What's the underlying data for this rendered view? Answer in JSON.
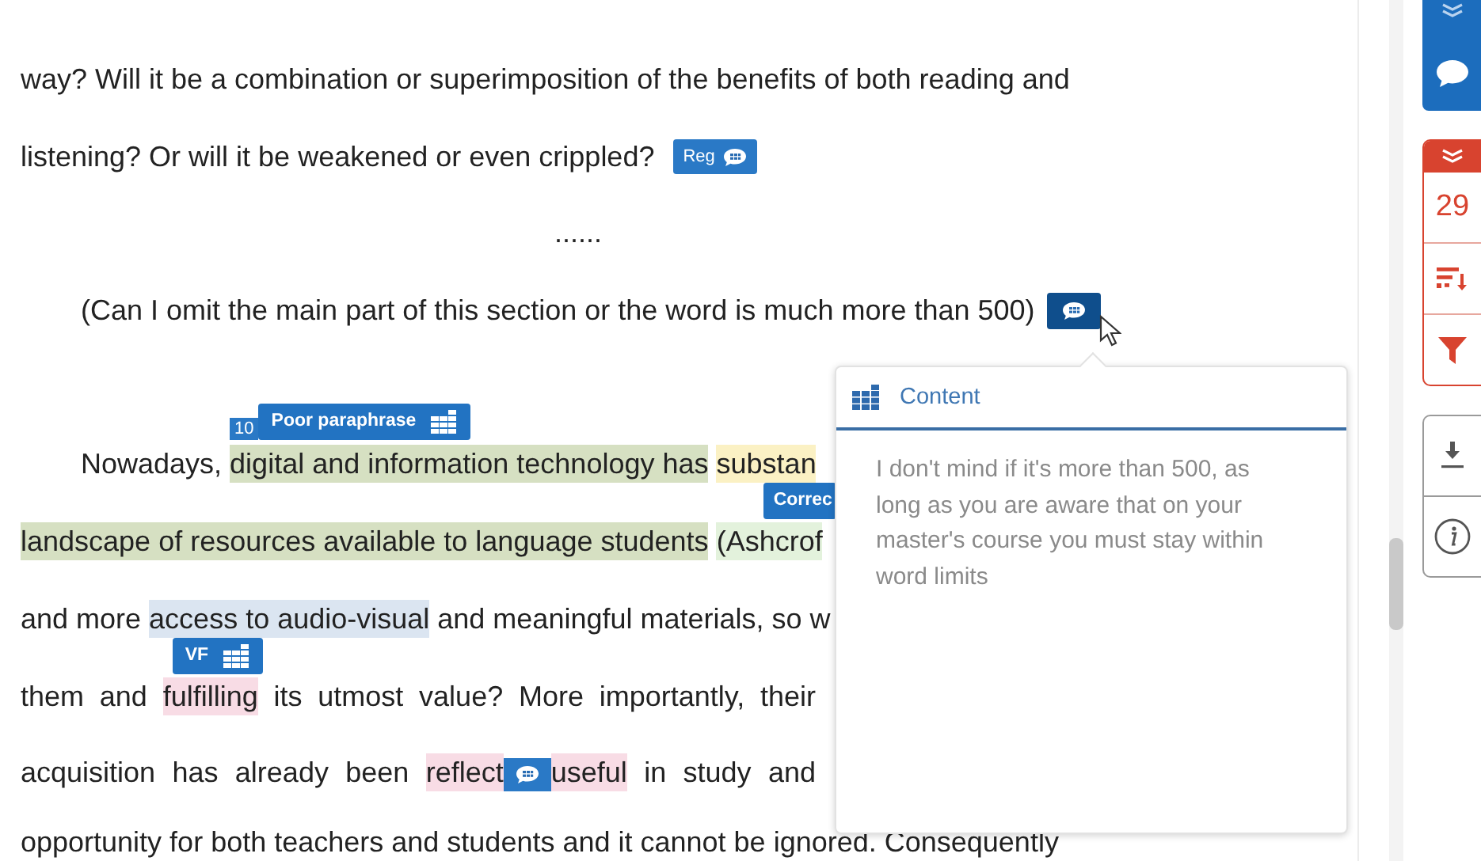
{
  "document": {
    "lines": [
      {
        "kind": "text",
        "segments": [
          {
            "text": "way? Will it be a combination or superimposition of the benefits of both reading and"
          }
        ]
      },
      {
        "kind": "text",
        "segments": [
          {
            "text": "listening? Or will it be weakened or even crippled?"
          },
          {
            "kind": "badge",
            "label": "Reg",
            "selected": false
          }
        ]
      },
      {
        "kind": "centered",
        "segments": [
          {
            "text": "......"
          }
        ]
      },
      {
        "kind": "indented",
        "segments": [
          {
            "text": "(Can I omit the main part of this section or the word is much more than 500)"
          },
          {
            "kind": "badge",
            "selected": true
          }
        ]
      },
      {
        "kind": "blank"
      },
      {
        "kind": "indented",
        "segments": [
          {
            "text": "Nowadays, "
          },
          {
            "text": "digital and information technology has",
            "color": "#d6e0c2",
            "tag": {
              "kind": "category",
              "number": "10",
              "label": "Poor paraphrase"
            }
          },
          {
            "text": "substan",
            "color": "#fbf1c4"
          }
        ]
      },
      {
        "kind": "text",
        "segments": [
          {
            "text": "landscape of resources available to language students",
            "color": "#d6e0c2"
          },
          {
            "text": "(Ashcrof",
            "color": "#e3f2dc",
            "tag": {
              "kind": "correction",
              "label": "Correc"
            }
          }
        ]
      },
      {
        "kind": "text",
        "segments": [
          {
            "text": "and more "
          },
          {
            "text": "access to audio-visual",
            "color": "#dbe5f1"
          },
          {
            "text": " and meaningful materials, so w"
          }
        ]
      },
      {
        "kind": "justified",
        "segments": [
          {
            "text": "them and "
          },
          {
            "text": "fulfilling",
            "color": "#f8dce5",
            "tag": {
              "kind": "category",
              "label": "VF"
            }
          },
          {
            "text": " its utmost value? More importantly, their"
          }
        ]
      },
      {
        "kind": "justified",
        "segments": [
          {
            "text": "acquisition has already been "
          },
          {
            "text": "reflect",
            "color": "#f8dce5"
          },
          {
            "kind": "badge",
            "selected": false
          },
          {
            "text": "useful",
            "color": "#f8dce5"
          },
          {
            "text": " in study and"
          }
        ]
      },
      {
        "kind": "text",
        "segments": [
          {
            "text": "opportunity for both teachers and students and it cannot be ignored. Consequently"
          }
        ]
      }
    ]
  },
  "popup": {
    "title": "Content",
    "body": "I don't mind if it's more than 500, as long as you are aware that on your master's course you must stay within word limits"
  },
  "sidebar": {
    "count": "29"
  }
}
